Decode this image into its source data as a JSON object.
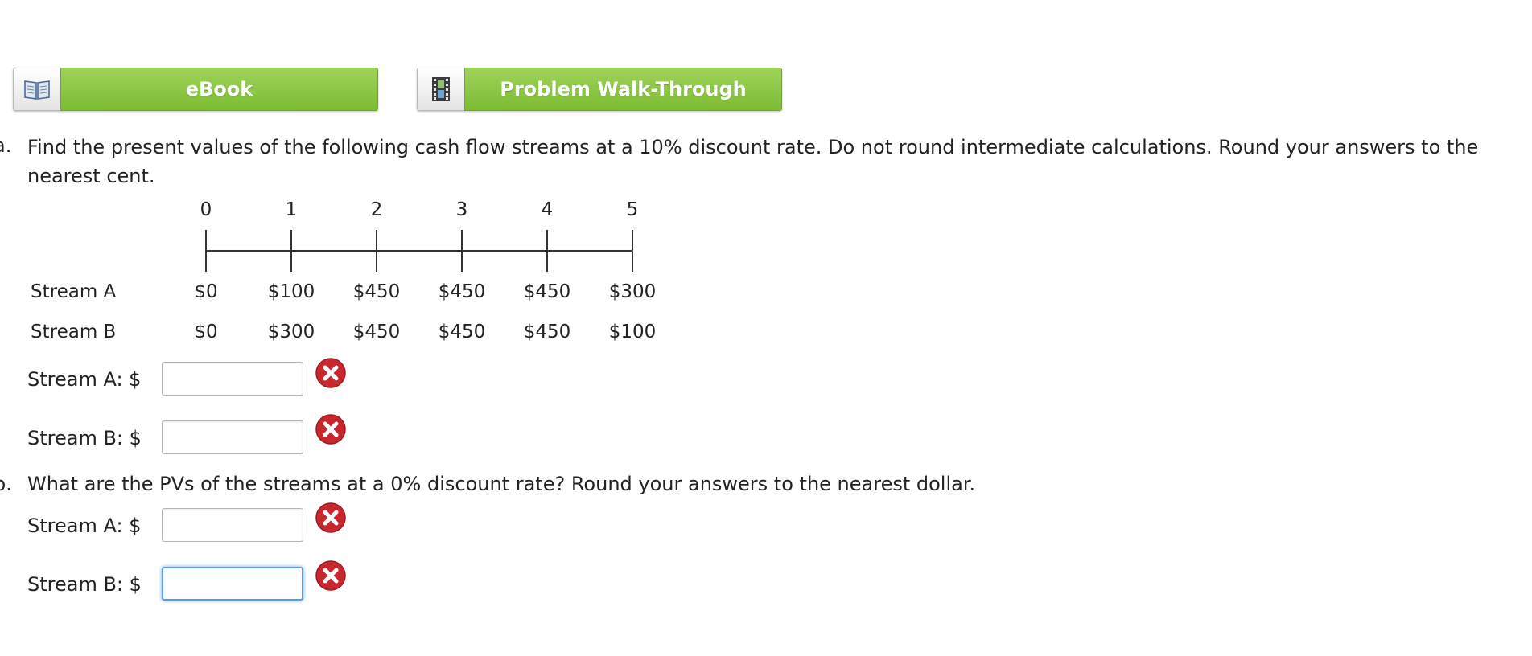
{
  "toolbar": {
    "ebook_label": "eBook",
    "walkthrough_label": "Problem Walk-Through"
  },
  "part_a": {
    "letter": "a.",
    "line1": "Find the present values of the following cash flow streams at a 10% discount rate. Do not round intermediate calculations. Round your answers to the",
    "line2": "nearest cent.",
    "stream_a_label": "Stream A: $",
    "stream_b_label": "Stream B: $",
    "stream_a_value": "",
    "stream_b_value": ""
  },
  "timeline": {
    "periods": [
      "0",
      "1",
      "2",
      "3",
      "4",
      "5"
    ],
    "rows": [
      {
        "label": "Stream A",
        "values": [
          "$0",
          "$100",
          "$450",
          "$450",
          "$450",
          "$300"
        ]
      },
      {
        "label": "Stream B",
        "values": [
          "$0",
          "$300",
          "$450",
          "$450",
          "$450",
          "$100"
        ]
      }
    ]
  },
  "part_b": {
    "letter": "b.",
    "text": "What are the PVs of the streams at a 0% discount rate? Round your answers to the nearest dollar.",
    "stream_a_label": "Stream A: $",
    "stream_b_label": "Stream B: $",
    "stream_a_value": "",
    "stream_b_value": ""
  },
  "icons": {
    "ebook": "book-icon",
    "walkthrough": "film-icon",
    "error": "error-x-icon"
  },
  "colors": {
    "button_green": "#7cbc33",
    "error_red": "#c8272d",
    "focus_blue": "#5b9be0"
  }
}
